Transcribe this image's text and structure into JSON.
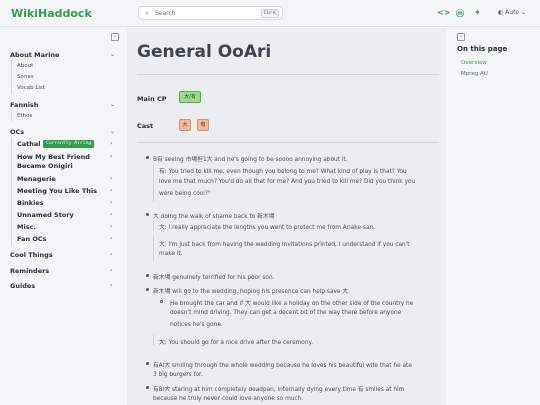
{
  "header": {
    "logo": "WikiHaddock",
    "search_placeholder": "Search",
    "search_shortcut": "Ctrl K",
    "icons": [
      "code-icon",
      "mastodon-icon",
      "bluesky-icon"
    ],
    "theme_label": "Auto"
  },
  "sidebar": {
    "sections": [
      {
        "label": "About Marine",
        "children": [
          "About",
          "Sonas",
          "Vocab List"
        ]
      },
      {
        "label": "Fannish",
        "children": [
          "Ethos"
        ]
      },
      {
        "label": "OCs"
      },
      {
        "label": "Cool Things"
      },
      {
        "label": "Reminders"
      },
      {
        "label": "Guides"
      }
    ],
    "ocs": [
      "Cathal",
      "How My Best Friend Became Onigiri",
      "Menagerie",
      "Meeting You Like This",
      "Binkies",
      "Unnamed Story",
      "Misc.",
      "Fan OCs"
    ],
    "ocs_line2": "Became Onigiri",
    "ocs_line1": "How My Best Friend",
    "badge": "Currently Airing"
  },
  "main": {
    "title": "General OoAri",
    "main_cp_label": "Main CP",
    "main_cp_chip": "大/有",
    "cast_label": "Cast",
    "cast_chips": [
      "大",
      "有"
    ],
    "lines": [
      "B有 seeing 市場担1大 and he's going to be soooo annoying about it.",
      "有: You tried to kill me, even though you belong to me? What kind of play is that? You",
      "love me that much? You'd do all that for me? And you tried to kill me? Did you think you",
      "were being cool?\"",
      "大 doing the walk of shame back to 新木場",
      "大: I really appreciate the lengths you went to protect me from Ariake-san.",
      "大: I'm just back from having the wedding invitations printed, I understand if you can't",
      "make it.",
      "新木場 genuinely terrified for his poor son.",
      "新木場 will go to the wedding, hoping his presence can help save 大.",
      "He brought the car and if 大 would like a holiday on the other side of the country he",
      "doesn't mind driving. They can get a decent bit of the way there before anyone",
      "notices he's gone.",
      "大: You should go for a nice drive after the ceremony.",
      "有Al大 smiling through the whole wedding because he loves his beautiful wife that he ate",
      "3 big burgers for.",
      "有Bl大 staring at him completely deadpan, internally dying every time 有 smiles at him",
      "because he truly never could love anyone so much."
    ]
  },
  "toc": {
    "title": "On this page",
    "items": [
      "Overview",
      "Mpreg AU"
    ]
  },
  "colors": {
    "accent": "#2e9e4a",
    "main_bg": "#ebedf0",
    "chip_green": "#9fdc8e",
    "chip_orange": "#f6b99c"
  }
}
